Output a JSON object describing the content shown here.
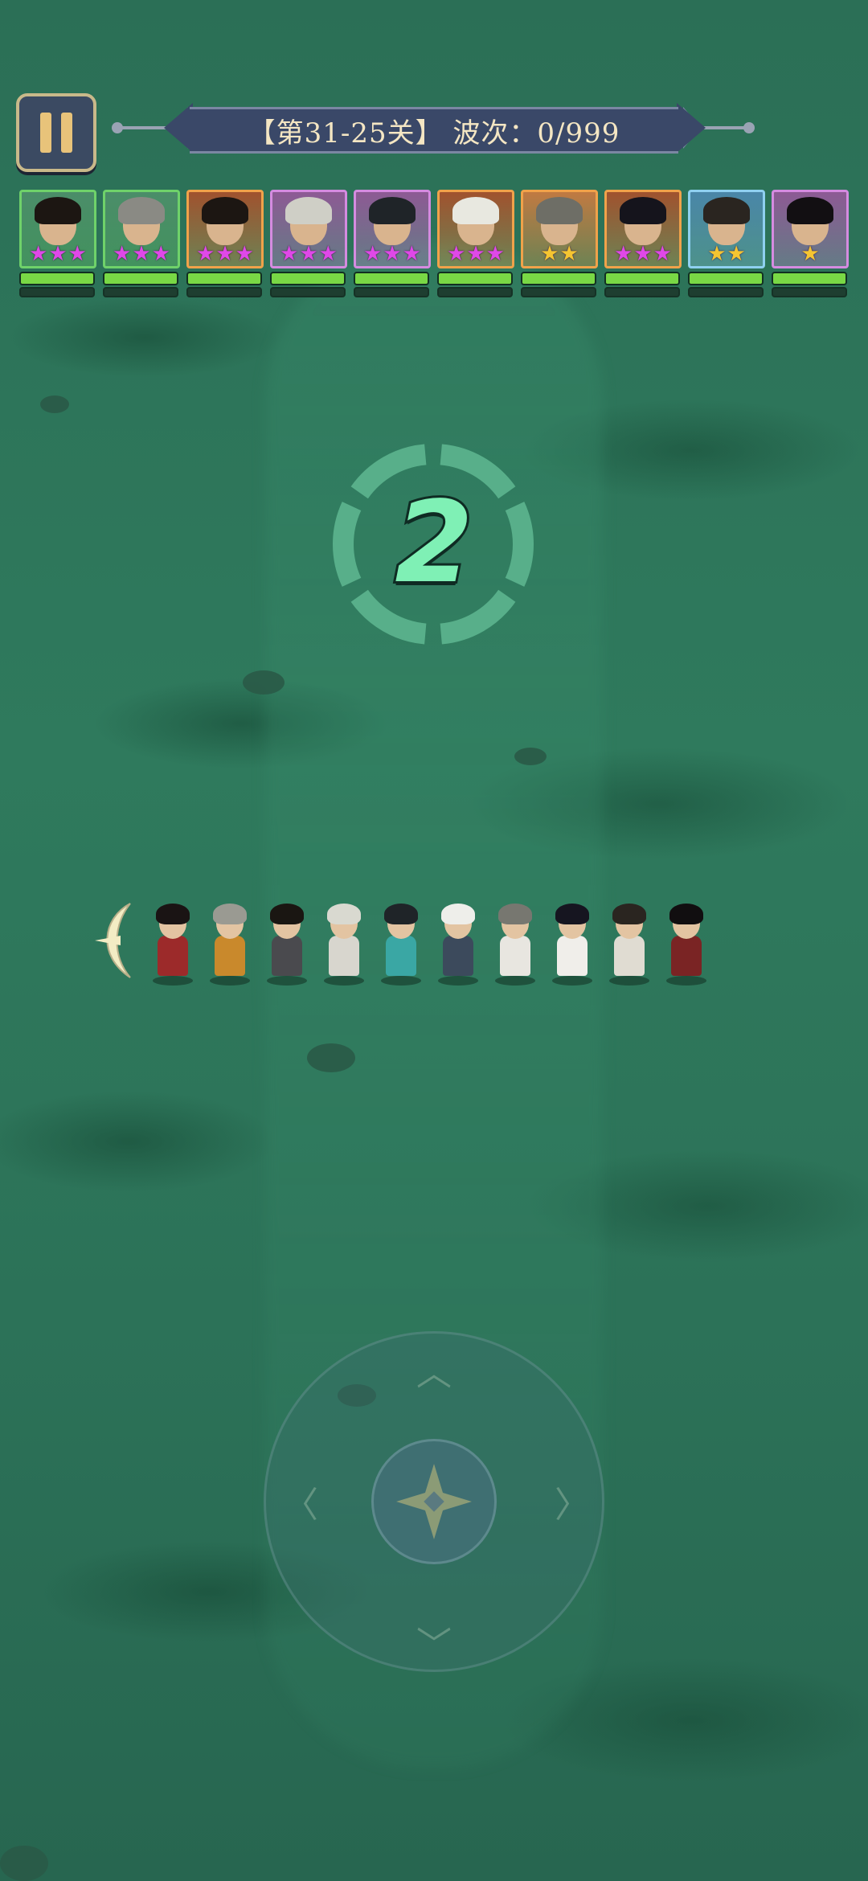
{
  "hud": {
    "stage_label": "【第31-25关】 波次：0/999"
  },
  "countdown": {
    "value": "2"
  },
  "roster": [
    {
      "name": "hero-1",
      "frame": "#6fd26a",
      "bg": "#4b8d69",
      "hair": "#1c1612",
      "stars": 3,
      "star_color": "#e048e8",
      "hp": 1.0
    },
    {
      "name": "hero-2",
      "frame": "#6fd26a",
      "bg": "#4b8d69",
      "hair": "#8a8a84",
      "stars": 3,
      "star_color": "#e048e8",
      "hp": 1.0
    },
    {
      "name": "hero-3",
      "frame": "#f0a24a",
      "bg": "#a0522e",
      "hair": "#1c1612",
      "stars": 3,
      "star_color": "#e048e8",
      "hp": 1.0
    },
    {
      "name": "hero-4",
      "frame": "#d58be0",
      "bg": "#8d5a94",
      "hair": "#cfcfc6",
      "stars": 3,
      "star_color": "#e048e8",
      "hp": 1.0
    },
    {
      "name": "hero-5",
      "frame": "#d58be0",
      "bg": "#8d5a94",
      "hair": "#1f2428",
      "stars": 3,
      "star_color": "#e048e8",
      "hp": 1.0
    },
    {
      "name": "hero-6",
      "frame": "#f0a24a",
      "bg": "#a0522e",
      "hair": "#e8e8e0",
      "stars": 3,
      "star_color": "#e048e8",
      "hp": 1.0
    },
    {
      "name": "hero-7",
      "frame": "#f0a24a",
      "bg": "#c07a42",
      "hair": "#6e6e66",
      "stars": 2,
      "star_color": "#f5c531",
      "hp": 1.0
    },
    {
      "name": "hero-8",
      "frame": "#f0a24a",
      "bg": "#a0522e",
      "hair": "#15141c",
      "stars": 3,
      "star_color": "#e048e8",
      "hp": 1.0
    },
    {
      "name": "hero-9",
      "frame": "#8fd0f0",
      "bg": "#4a86a8",
      "hair": "#2a2520",
      "stars": 2,
      "star_color": "#f5c531",
      "hp": 1.0
    },
    {
      "name": "hero-10",
      "frame": "#d58be0",
      "bg": "#8d5a94",
      "hair": "#120f12",
      "stars": 1,
      "star_color": "#f5c531",
      "hp": 1.0
    }
  ],
  "party_line": [
    {
      "body": "#9c2a2a",
      "hair": "#1a1414"
    },
    {
      "body": "#c9892c",
      "hair": "#9a9a92"
    },
    {
      "body": "#4a4a4e",
      "hair": "#1a1612"
    },
    {
      "body": "#d8d6ce",
      "hair": "#d9d9d0"
    },
    {
      "body": "#3aa7a4",
      "hair": "#1f2428"
    },
    {
      "body": "#3c4a5c",
      "hair": "#eeeeea"
    },
    {
      "body": "#e8e6e0",
      "hair": "#777770"
    },
    {
      "body": "#f0eeea",
      "hair": "#161520"
    },
    {
      "body": "#e0dcd2",
      "hair": "#2a2520"
    },
    {
      "body": "#7a2424",
      "hair": "#110e10"
    }
  ]
}
